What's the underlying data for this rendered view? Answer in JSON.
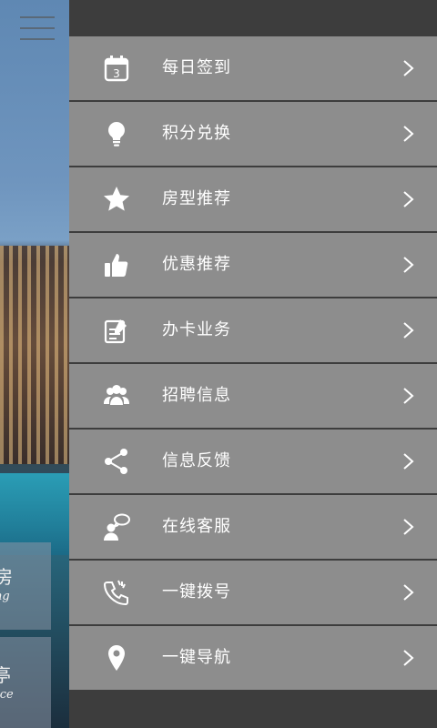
{
  "background": {
    "card1": {
      "zh": "房",
      "en": "king"
    },
    "card2": {
      "zh": "亭",
      "en": "rvice"
    }
  },
  "menu": {
    "items": [
      {
        "label": "每日签到",
        "icon": "calendar-icon",
        "badge": "3"
      },
      {
        "label": "积分兑换",
        "icon": "lightbulb-icon"
      },
      {
        "label": "房型推荐",
        "icon": "star-icon"
      },
      {
        "label": "优惠推荐",
        "icon": "thumbs-up-icon"
      },
      {
        "label": "办卡业务",
        "icon": "card-form-icon"
      },
      {
        "label": "招聘信息",
        "icon": "people-icon"
      },
      {
        "label": "信息反馈",
        "icon": "share-icon"
      },
      {
        "label": "在线客服",
        "icon": "chat-user-icon"
      },
      {
        "label": "一键拨号",
        "icon": "phone-icon"
      },
      {
        "label": "一键导航",
        "icon": "map-pin-icon"
      }
    ]
  },
  "colors": {
    "drawer_bg": "#3d3d3d",
    "item_bg": "#8d8d8d",
    "text": "#ffffff"
  }
}
